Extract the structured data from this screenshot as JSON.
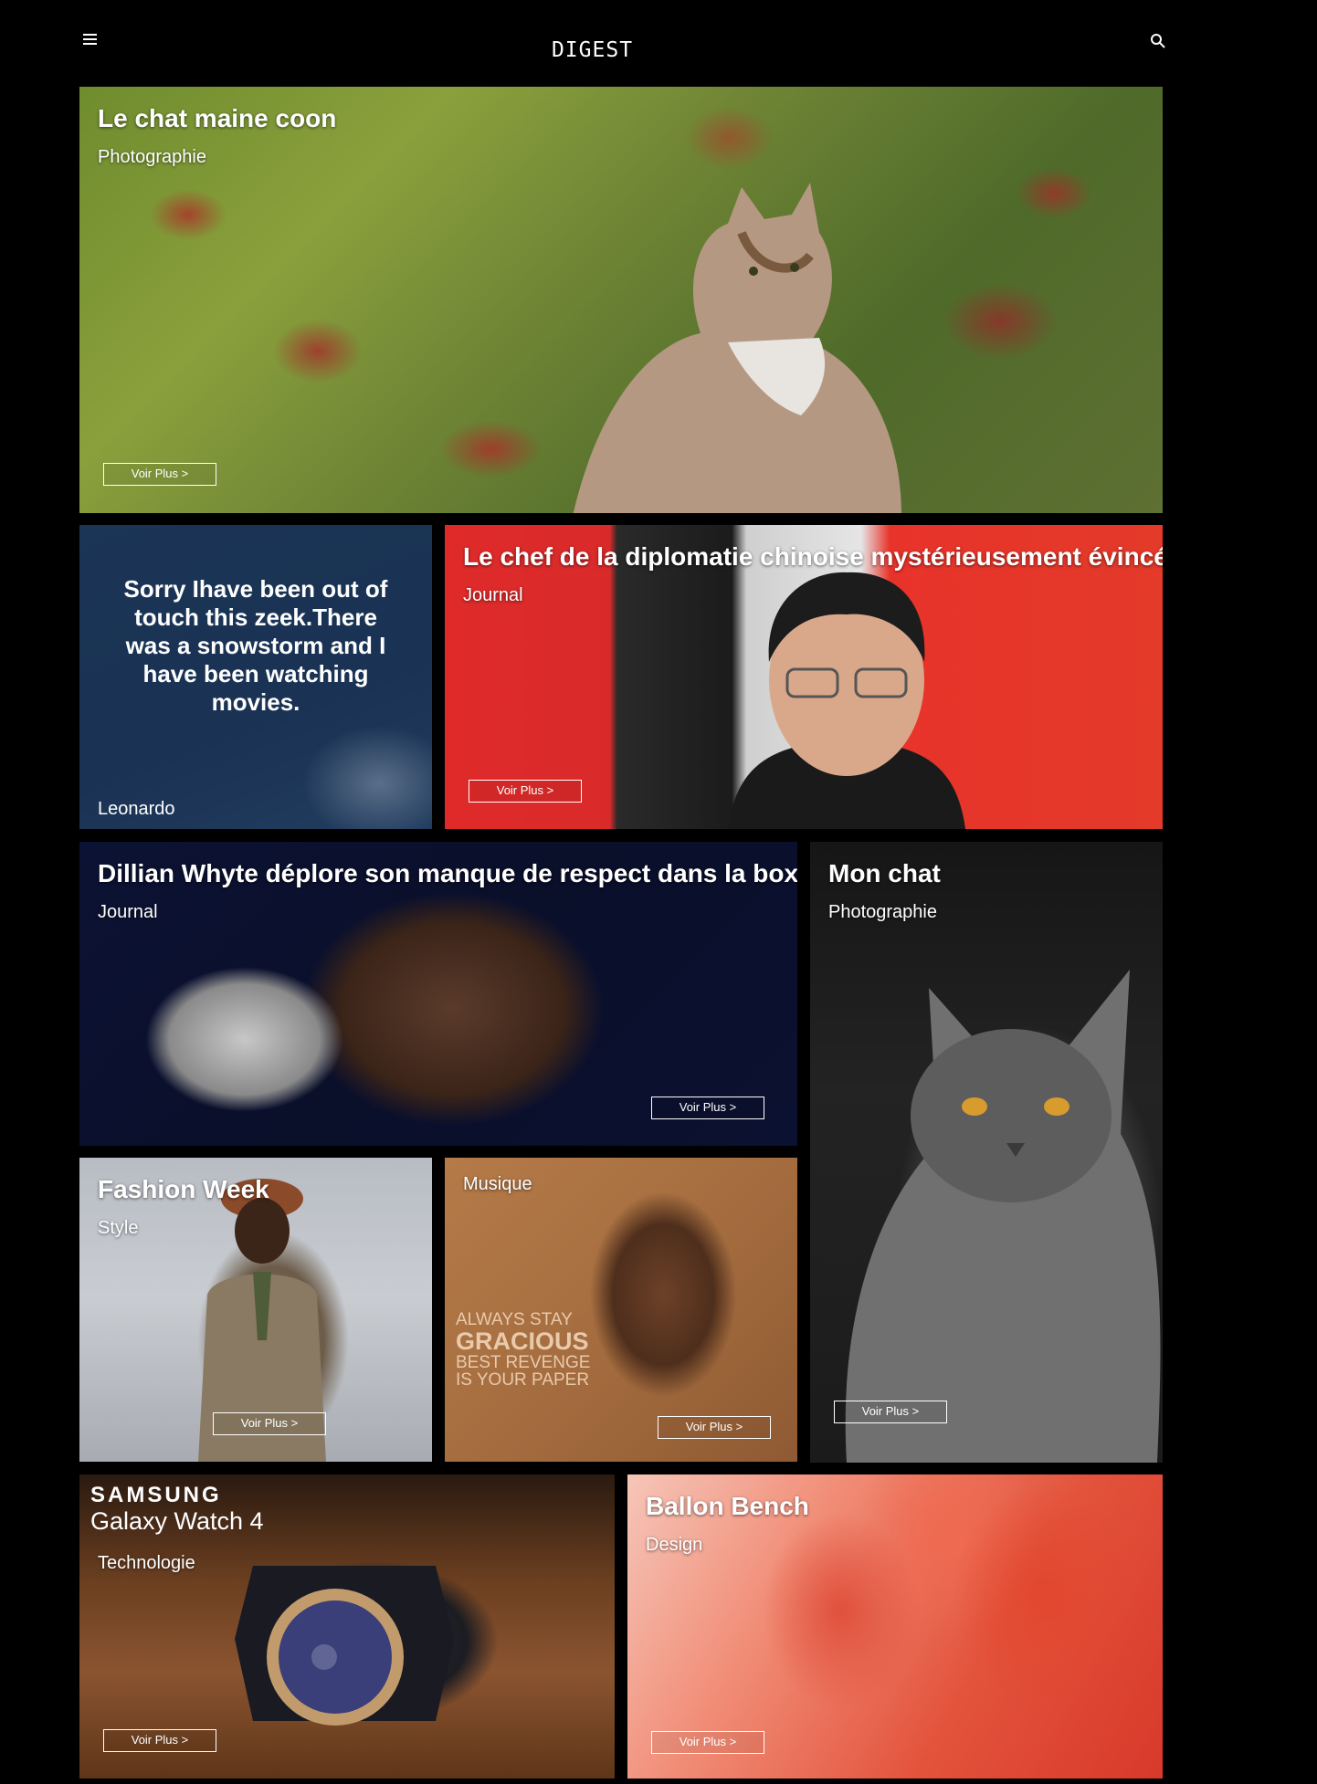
{
  "header": {
    "brand": "DIGEST",
    "menu_icon": "hamburger-menu-icon",
    "search_icon": "search-icon"
  },
  "cards": [
    {
      "title": "Le chat maine coon",
      "category": "Photographie",
      "cta": "Voir Plus >"
    },
    {
      "quote": "Sorry Ihave been out of touch this zeek.There was a snowstorm and I have been watching movies.",
      "author": "Leonardo"
    },
    {
      "title": "Le chef de la diplomatie chinoise mystérieusement évincé",
      "category": "Journal",
      "cta": "Voir Plus >"
    },
    {
      "title": "Dillian Whyte déplore son manque de respect dans la boxe",
      "category": "Journal",
      "cta": "Voir Plus >"
    },
    {
      "title": "Mon chat",
      "category": "Photographie",
      "cta": "Voir Plus >"
    },
    {
      "title": "Fashion Week",
      "category": "Style",
      "cta": "Voir Plus >"
    },
    {
      "category": "Musique",
      "cta": "Voir Plus >",
      "image_text": {
        "line1": "Always stay",
        "line2": "Gracious",
        "line3": "Best revenge",
        "line4": "is your paper"
      }
    },
    {
      "brand_line1": "SAMSUNG",
      "brand_line2": "Galaxy Watch 4",
      "category": "Technologie",
      "cta": "Voir Plus >"
    },
    {
      "title": "Ballon Bench",
      "category": "Design",
      "cta": "Voir Plus >"
    }
  ]
}
